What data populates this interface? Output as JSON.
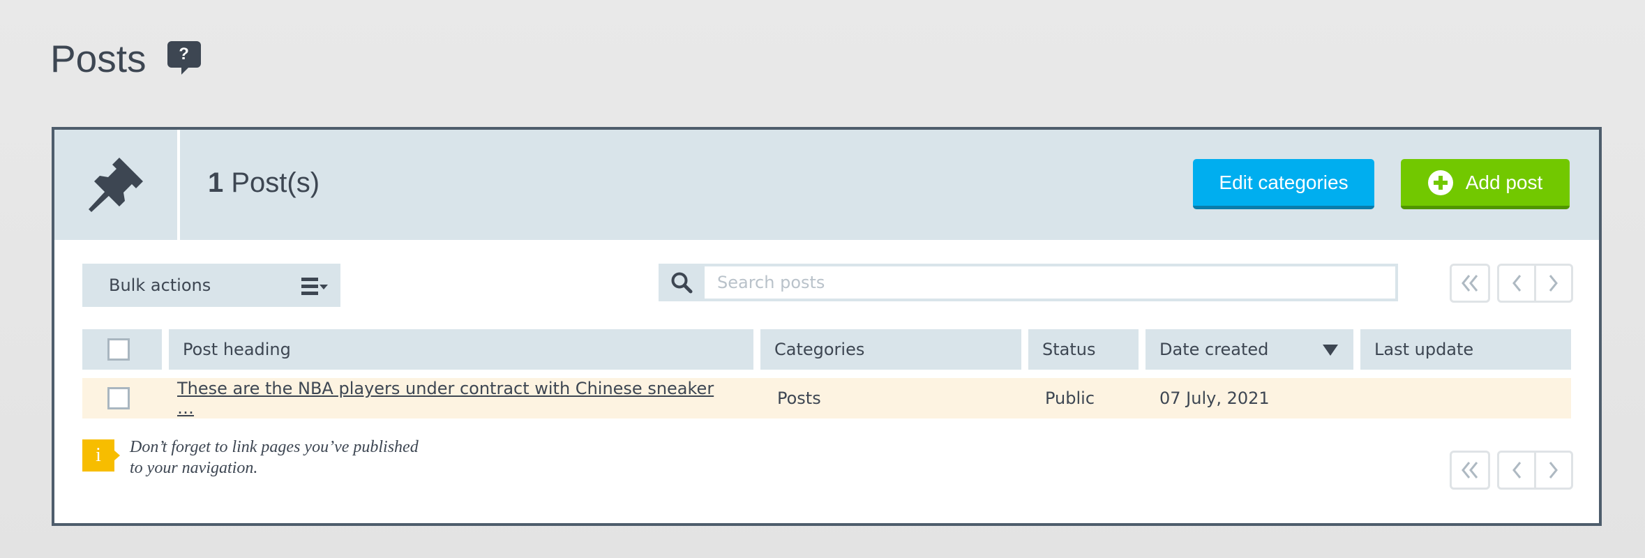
{
  "page": {
    "title": "Posts",
    "help_icon": "question-bubble-icon",
    "help_label": "?"
  },
  "panel": {
    "icon": "pushpin-icon",
    "count_number": "1",
    "count_label": " Post(s)",
    "buttons": {
      "edit_categories": "Edit categories",
      "add_post": "Add post"
    },
    "colors": {
      "edit_button": "#00aeef",
      "add_button": "#72c800",
      "header_bg": "#d9e4ea",
      "row_highlight": "#fdf3e1",
      "info_icon": "#f7bd00"
    }
  },
  "toolbar": {
    "bulk_actions_label": "Bulk actions",
    "search_placeholder": "Search posts",
    "search_value": ""
  },
  "pagination": {
    "first_icon": "double-chevron-left-icon",
    "prev_icon": "chevron-left-icon",
    "next_icon": "chevron-right-icon"
  },
  "table": {
    "columns": [
      "Post heading",
      "Categories",
      "Status",
      "Date created",
      "Last update"
    ],
    "sorted_column": "Date created",
    "sort_direction": "descending",
    "rows": [
      {
        "heading": "These are the NBA players under contract with Chinese sneaker …",
        "category": "Posts",
        "status": "Public",
        "date_created": "07 July, 2021",
        "last_update": ""
      }
    ]
  },
  "notice": {
    "icon_label": "i",
    "line1": "Don’t forget to link pages you’ve published",
    "line2": "to your navigation."
  }
}
